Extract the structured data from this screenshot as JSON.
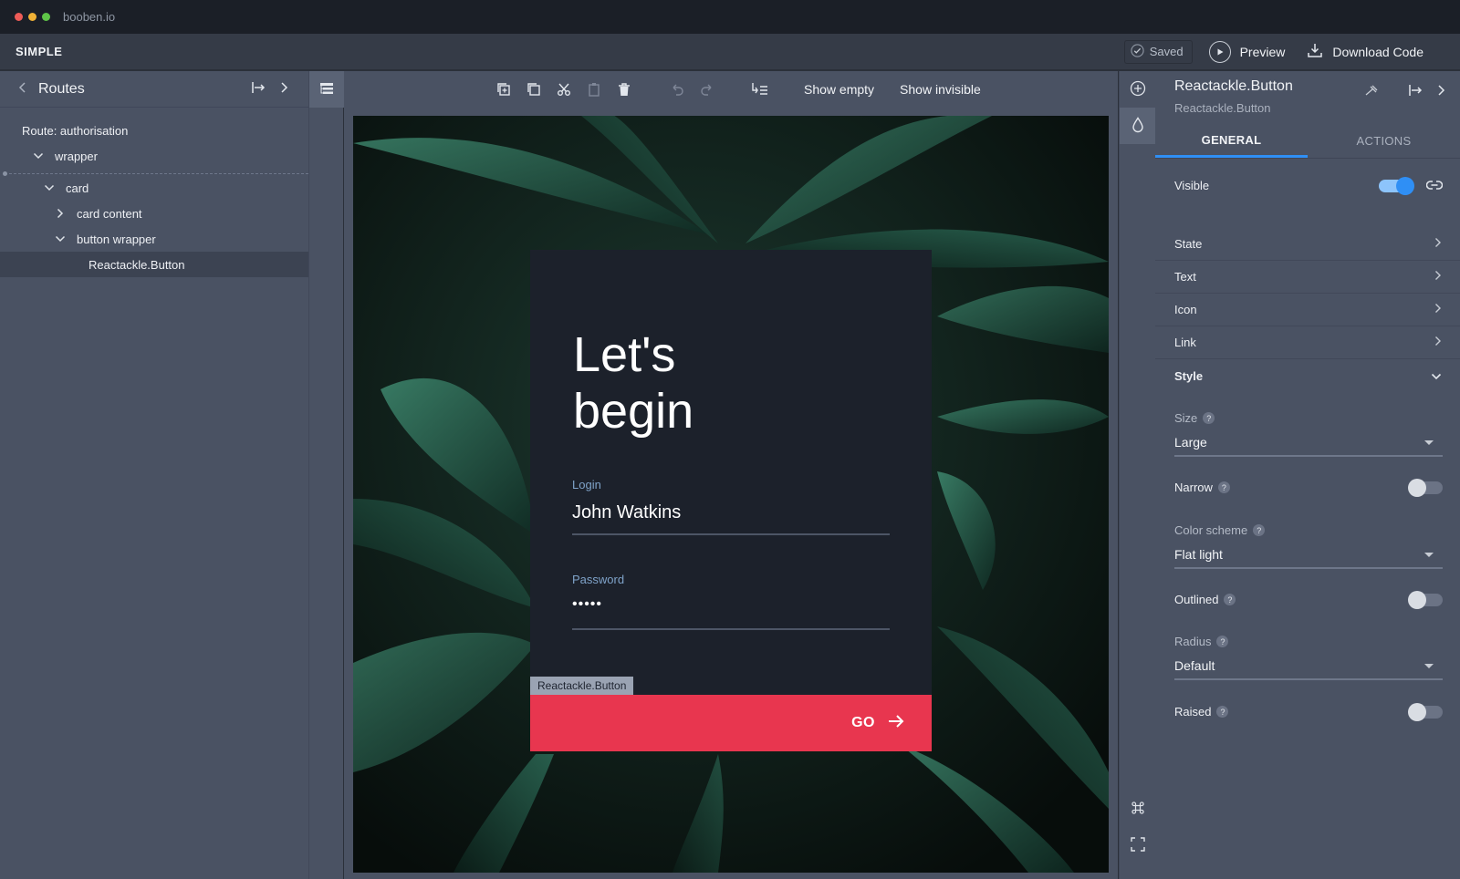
{
  "window": {
    "title": "booben.io"
  },
  "appbar": {
    "brand": "SIMPLE",
    "saved_label": "Saved",
    "preview_label": "Preview",
    "download_label": "Download Code"
  },
  "routes_panel": {
    "title": "Routes",
    "tree": [
      {
        "label": "Route: authorisation"
      },
      {
        "label": "wrapper"
      },
      {
        "label": "card"
      },
      {
        "label": "card content"
      },
      {
        "label": "button wrapper"
      },
      {
        "label": "Reactackle.Button"
      }
    ]
  },
  "toolbar": {
    "show_empty": "Show empty",
    "show_invisible": "Show invisible"
  },
  "preview": {
    "heading_line1": "Let's",
    "heading_line2": "begin",
    "login_label": "Login",
    "login_value": "John Watkins",
    "password_label": "Password",
    "password_value": "•••••",
    "selected_tag": "Reactackle.Button",
    "button_label": "GO"
  },
  "props_panel": {
    "title": "Reactackle.Button",
    "subtitle": "Reactackle.Button",
    "tabs": [
      {
        "label": "GENERAL",
        "active": true
      },
      {
        "label": "ACTIONS",
        "active": false
      }
    ],
    "visible_label": "Visible",
    "visible_on": true,
    "sections": [
      {
        "label": "State"
      },
      {
        "label": "Text"
      },
      {
        "label": "Icon"
      },
      {
        "label": "Link"
      }
    ],
    "style_label": "Style",
    "size_label": "Size",
    "size_value": "Large",
    "narrow_label": "Narrow",
    "color_scheme_label": "Color scheme",
    "color_scheme_value": "Flat light",
    "outlined_label": "Outlined",
    "radius_label": "Radius",
    "radius_value": "Default",
    "raised_label": "Raised",
    "help_glyph": "?"
  },
  "colors": {
    "accent": "#2f8ff5",
    "button": "#e8364f",
    "card": "#1c212b",
    "panel": "#4a5263"
  }
}
